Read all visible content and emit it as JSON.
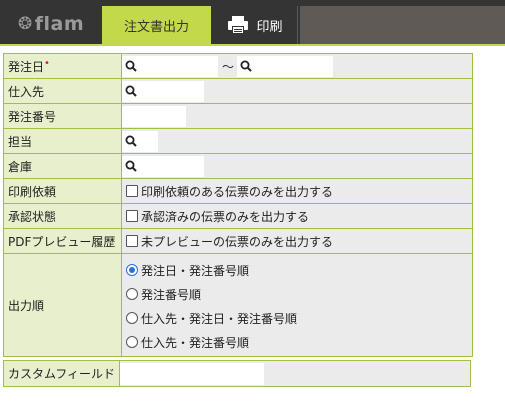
{
  "header": {
    "logo_mark": "❂",
    "logo_text": "flam",
    "active_tab": "注文書出力",
    "print_tab": "印刷"
  },
  "form": {
    "order_date_label": "発注日",
    "required_mark": "•",
    "range_sep": "〜",
    "supplier_label": "仕入先",
    "order_no_label": "発注番号",
    "staff_label": "担当",
    "warehouse_label": "倉庫",
    "print_request_label": "印刷依頼",
    "print_request_option": "印刷依頼のある伝票のみを出力する",
    "approval_label": "承認状態",
    "approval_option": "承認済みの伝票のみを出力する",
    "pdf_preview_label": "PDFプレビュー履歴",
    "pdf_preview_option": "未プレビューの伝票のみを出力する",
    "output_order_label": "出力順",
    "output_order_options": [
      "発注日・発注番号順",
      "発注番号順",
      "仕入先・発注日・発注番号順",
      "仕入先・発注番号順"
    ],
    "output_order_selected": 0
  },
  "custom": {
    "label": "カスタムフィールド"
  },
  "colors": {
    "accent": "#c4d94a",
    "label_bg": "#e7efcc",
    "border": "#9fbf45",
    "topbar": "#343434",
    "required": "#e0202a",
    "radio_on": "#2c6fd6"
  }
}
